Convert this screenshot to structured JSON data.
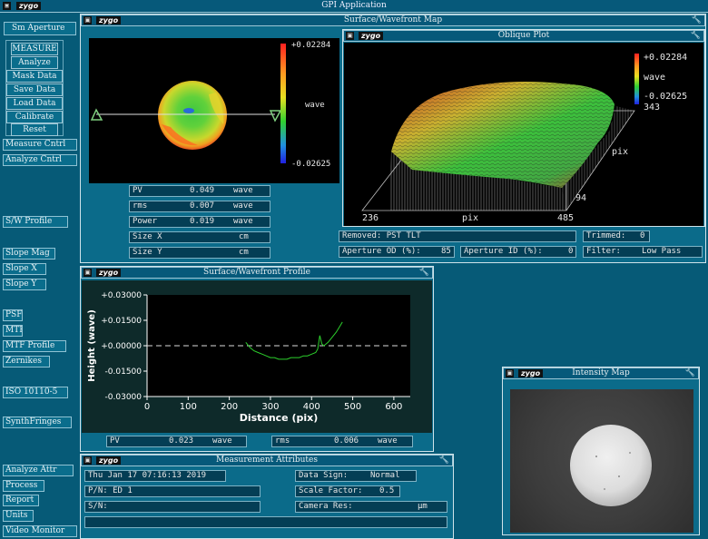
{
  "app": {
    "title": "GPI Application",
    "logo": "zygo"
  },
  "sidebar": {
    "top_button": "Sm Aperture",
    "panel_buttons": [
      "MEASURE",
      "Analyze",
      "Mask Data",
      "Save Data",
      "Load Data",
      "Calibrate",
      "Reset"
    ],
    "items_a": [
      "Measure Cntrl",
      "Analyze Cntrl"
    ],
    "item_sw": "S/W Profile",
    "items_slope": [
      "Slope Mag",
      "Slope X",
      "Slope Y"
    ],
    "items_psf": [
      "PSF",
      "MTF",
      "MTF Profile",
      "Zernikes"
    ],
    "item_iso": "ISO 10110-5",
    "item_synth": "SynthFringes",
    "items_bottom": [
      "Analyze Attr",
      "Process",
      "Report",
      "Units",
      "Video Monitor"
    ]
  },
  "surface_map": {
    "title": "Surface/Wavefront Map",
    "colorbar": {
      "max": "+0.02284",
      "unit": "wave",
      "min": "-0.02625"
    },
    "stats": [
      {
        "label": "PV",
        "value": "0.049",
        "unit": "wave"
      },
      {
        "label": "rms",
        "value": "0.007",
        "unit": "wave"
      },
      {
        "label": "Power",
        "value": "0.019",
        "unit": "wave"
      },
      {
        "label": "Size X",
        "value": "",
        "unit": "cm"
      },
      {
        "label": "Size Y",
        "value": "",
        "unit": "cm"
      }
    ],
    "removed": "Removed: PST TLT",
    "trimmed_label": "Trimmed:",
    "trimmed_value": "0",
    "aperture_od_label": "Aperture OD (%):",
    "aperture_od_value": "85",
    "aperture_id_label": "Aperture ID (%):",
    "aperture_id_value": "0",
    "filter_label": "Filter:",
    "filter_value": "Low Pass"
  },
  "oblique_plot": {
    "title": "Oblique Plot",
    "colorbar": {
      "max": "+0.02284",
      "unit": "wave",
      "min": "-0.02625"
    },
    "axis": {
      "y_top": "343",
      "y_unit": "pix",
      "y_bottom": "94",
      "x_left": "236",
      "x_unit": "pix",
      "x_right": "485"
    }
  },
  "profile": {
    "title": "Surface/Wavefront Profile",
    "stats": [
      {
        "label": "PV",
        "value": "0.023",
        "unit": "wave"
      },
      {
        "label": "rms",
        "value": "0.006",
        "unit": "wave"
      }
    ]
  },
  "chart_data": {
    "type": "line",
    "xlabel": "Distance (pix)",
    "ylabel": "Height (wave)",
    "xlim": [
      0,
      640
    ],
    "ylim": [
      -0.03,
      0.03
    ],
    "xticks": [
      "0",
      "100",
      "200",
      "300",
      "400",
      "500",
      "600"
    ],
    "yticks": [
      "+0.03000",
      "+0.01500",
      "+0.00000",
      "-0.01500",
      "-0.03000"
    ],
    "series": [
      {
        "x": [
          240,
          250,
          260,
          270,
          280,
          290,
          300,
          310,
          320,
          330,
          340,
          350,
          360,
          370,
          380,
          390,
          400,
          410,
          415,
          420,
          425,
          430,
          440,
          450,
          460,
          470,
          475
        ],
        "y": [
          0.002,
          -0.001,
          -0.003,
          -0.004,
          -0.005,
          -0.006,
          -0.007,
          -0.007,
          -0.008,
          -0.008,
          -0.008,
          -0.007,
          -0.007,
          -0.007,
          -0.006,
          -0.006,
          -0.005,
          -0.004,
          -0.002,
          0.006,
          0.001,
          0.0,
          0.002,
          0.005,
          0.008,
          0.012,
          0.014
        ]
      }
    ],
    "reference_line_y": 0.0
  },
  "intensity_map": {
    "title": "Intensity Map"
  },
  "attributes": {
    "title": "Measurement Attributes",
    "date": "Thu Jan 17 07:16:13 2019",
    "pn": "P/N:  ED 1",
    "sn": "S/N:",
    "data_sign_label": "Data Sign:",
    "data_sign_value": "Normal",
    "scale_label": "Scale Factor:",
    "scale_value": "0.5",
    "camera_label": "Camera Res:",
    "camera_unit": "µm"
  },
  "icons": {
    "close": "x-icon",
    "settings": "wrench-icon"
  },
  "colors": {
    "background": "#065a77",
    "plot_bg": "#000000",
    "profile_line": "#2ccf2c"
  }
}
